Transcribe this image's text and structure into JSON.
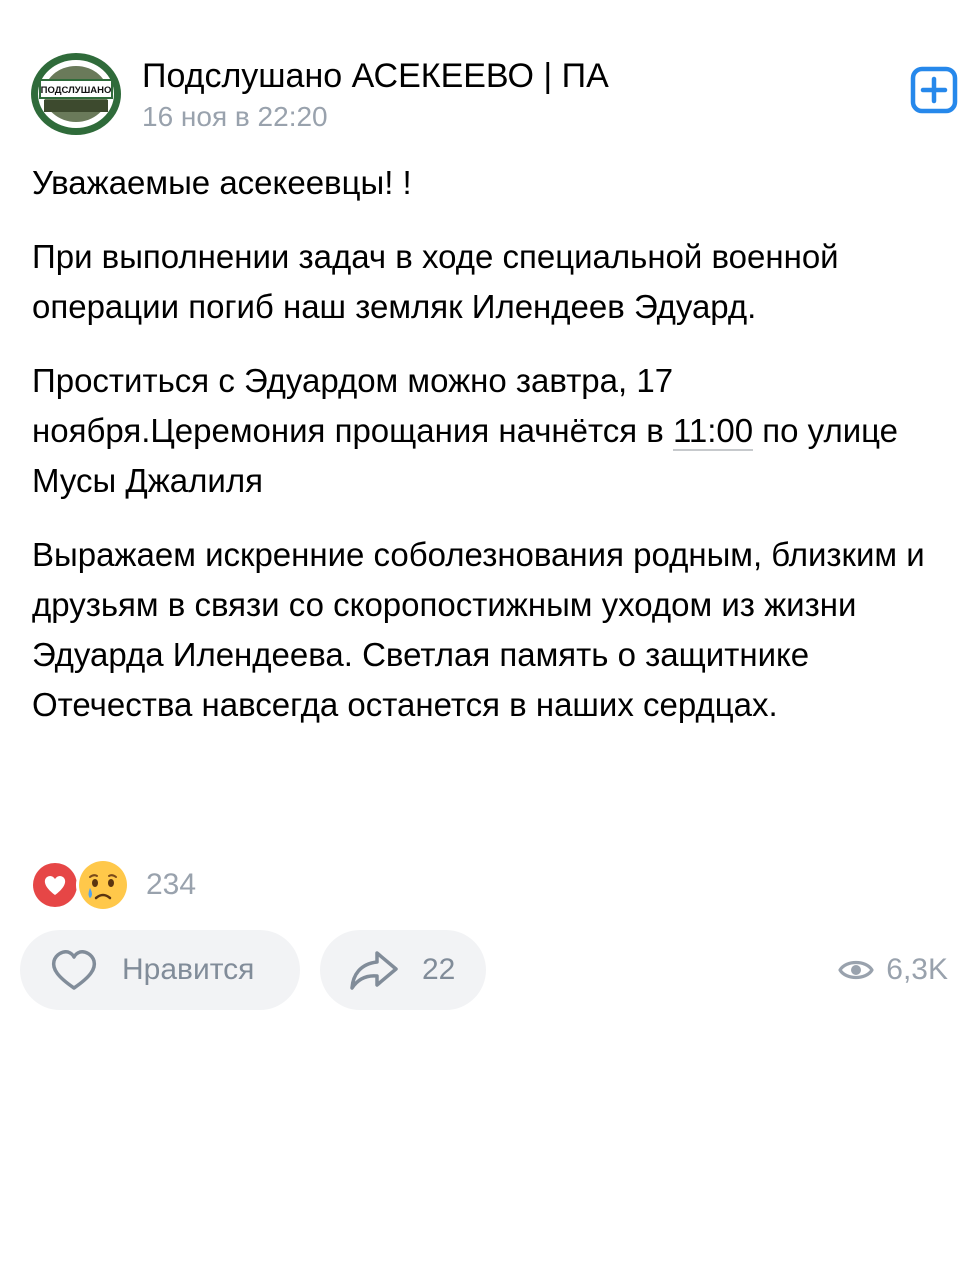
{
  "header": {
    "group_name": "Подслушано АСЕКЕЕВО | ПА",
    "date": "16 ноя в 22:20",
    "avatar_banner": "ПОДСЛУШАНО"
  },
  "post": {
    "p1": "Уважаемые асекеевцы! !",
    "p2": "При выполнении задач в ходе специальной военной операции погиб наш земляк Илендеев Эдуард.",
    "p3_before": "Проститься с Эдуардом можно завтра, 17 ноября.Церемония прощания начнётся в ",
    "p3_time": "11:00",
    "p3_after": " по улице Мусы Джалиля",
    "p4": "Выражаем искренние соболезнования родным, близким и друзьям в связи со скоропостижным уходом из жизни Эдуарда Илендеева. Светлая память о защитнике Отечества навсегда останется в наших сердцах."
  },
  "reactions": {
    "count": "234",
    "icons": [
      "heart-icon",
      "crying-emoji-icon"
    ]
  },
  "actions": {
    "like_label": "Нравится",
    "share_count": "22",
    "views_count": "6,3K"
  },
  "colors": {
    "accent": "#2688eb",
    "secondary_text": "#99a2ad",
    "pill_bg": "#f2f3f5",
    "heart": "#e64646"
  }
}
